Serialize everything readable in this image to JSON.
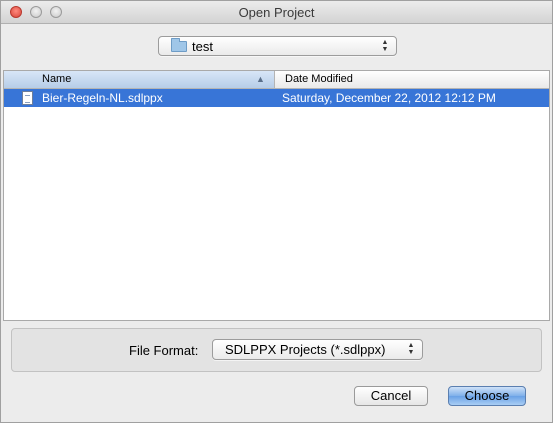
{
  "window": {
    "title": "Open Project"
  },
  "location": {
    "current_folder": "test",
    "icon": "folder-icon"
  },
  "columns": {
    "name": "Name",
    "date_modified": "Date Modified"
  },
  "files": [
    {
      "name": "Bier-Regeln-NL.sdlppx",
      "date_modified": "Saturday, December 22, 2012 12:12 PM",
      "selected": true,
      "icon": "document-icon"
    }
  ],
  "format": {
    "label": "File Format:",
    "selected": "SDLPPX Projects (*.sdlppx)"
  },
  "buttons": {
    "cancel": "Cancel",
    "choose": "Choose"
  },
  "colors": {
    "selection": "#3875d7",
    "default_button": "#7fb0ea",
    "close": "#d8463a"
  }
}
